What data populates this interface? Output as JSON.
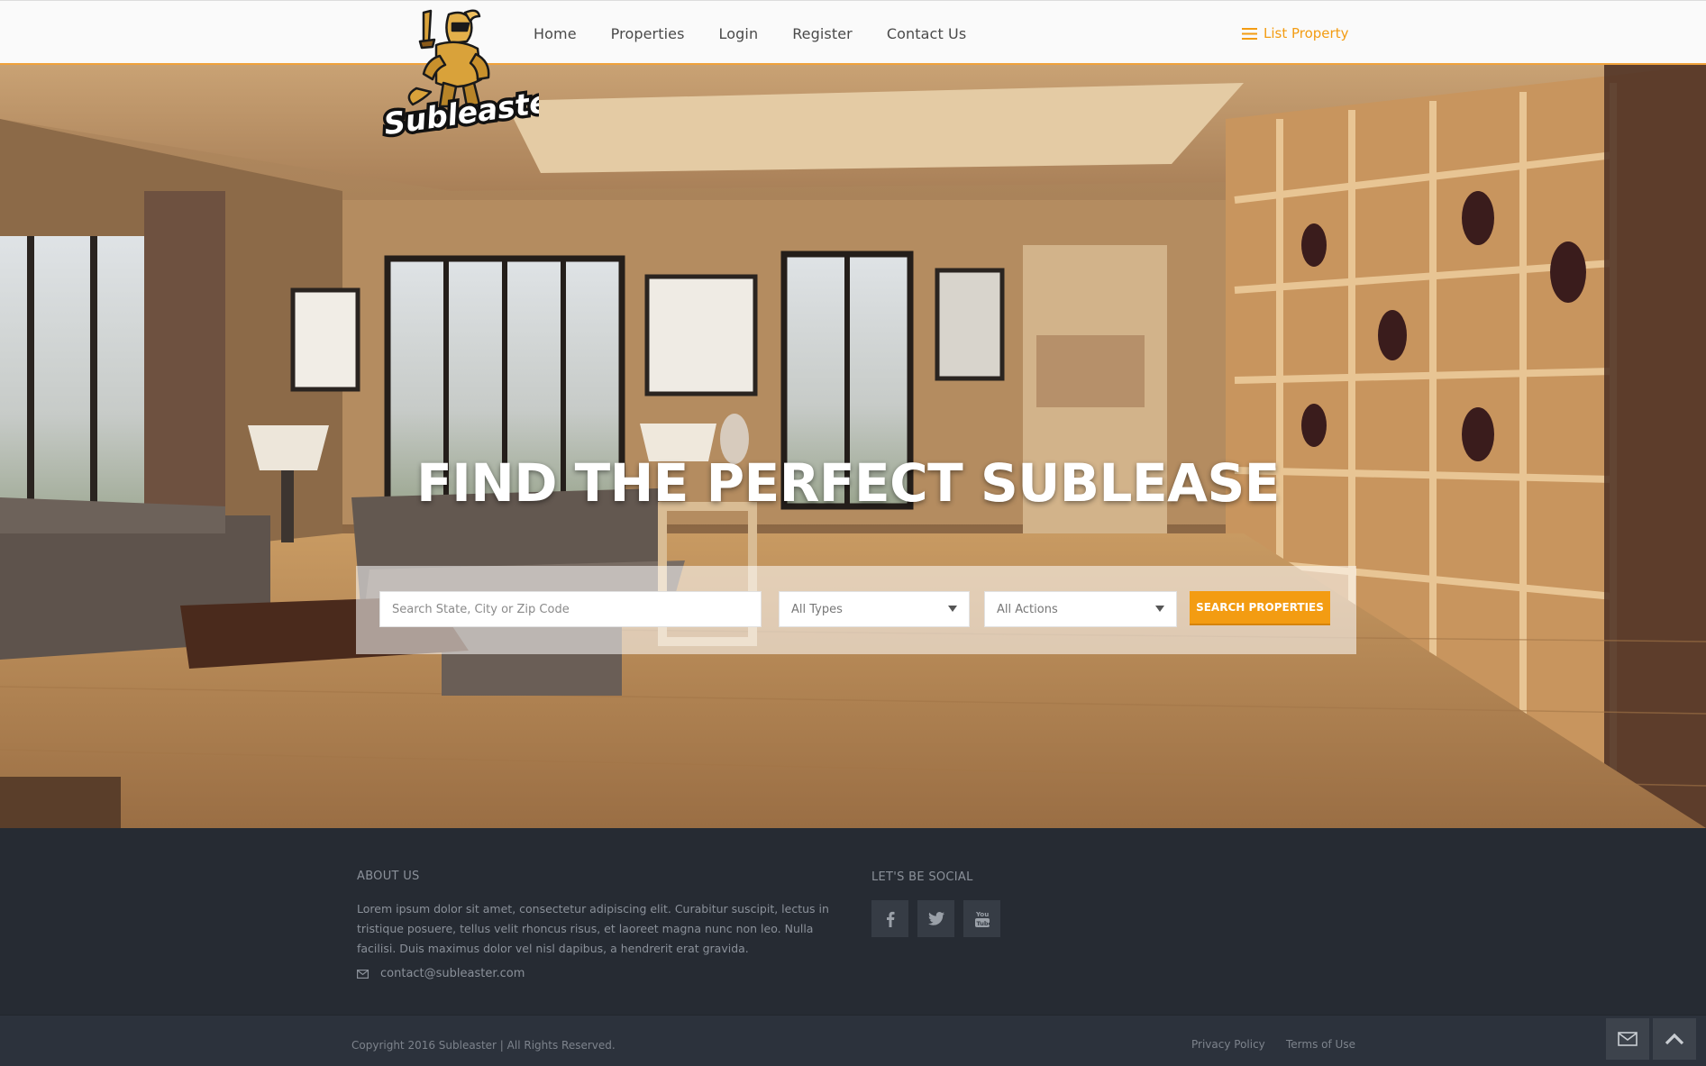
{
  "header": {
    "logo_text": "Subleaster",
    "nav": [
      {
        "label": "Home"
      },
      {
        "label": "Properties"
      },
      {
        "label": "Login"
      },
      {
        "label": "Register"
      },
      {
        "label": "Contact Us"
      }
    ],
    "list_property_label": "List Property",
    "accent_color": "#f39c12"
  },
  "hero": {
    "title": "FIND THE PERFECT SUBLEASE",
    "search": {
      "placeholder": "Search State, City or Zip Code",
      "value": "",
      "type_select": "All Types",
      "action_select": "All Actions",
      "button_label": "SEARCH PROPERTIES"
    }
  },
  "footer": {
    "about_heading": "ABOUT US",
    "about_text": "Lorem ipsum dolor sit amet, consectetur adipiscing elit. Curabitur suscipit, lectus in tristique posuere, tellus velit rhoncus risus, et laoreet magna nunc non leo. Nulla facilisi. Duis maximus dolor vel nisl dapibus, a hendrerit erat gravida.",
    "email": "contact@subleaster.com",
    "social_heading": "LET'S BE SOCIAL",
    "social": [
      {
        "icon": "facebook-icon"
      },
      {
        "icon": "twitter-icon"
      },
      {
        "icon": "youtube-icon"
      }
    ],
    "copyright": "Copyright 2016 Subleaster | All Rights Reserved.",
    "links": [
      {
        "label": "Privacy Policy"
      },
      {
        "label": "Terms of Use"
      }
    ]
  },
  "floating": {
    "mail_icon": "envelope-icon",
    "top_icon": "chevron-up-icon"
  }
}
